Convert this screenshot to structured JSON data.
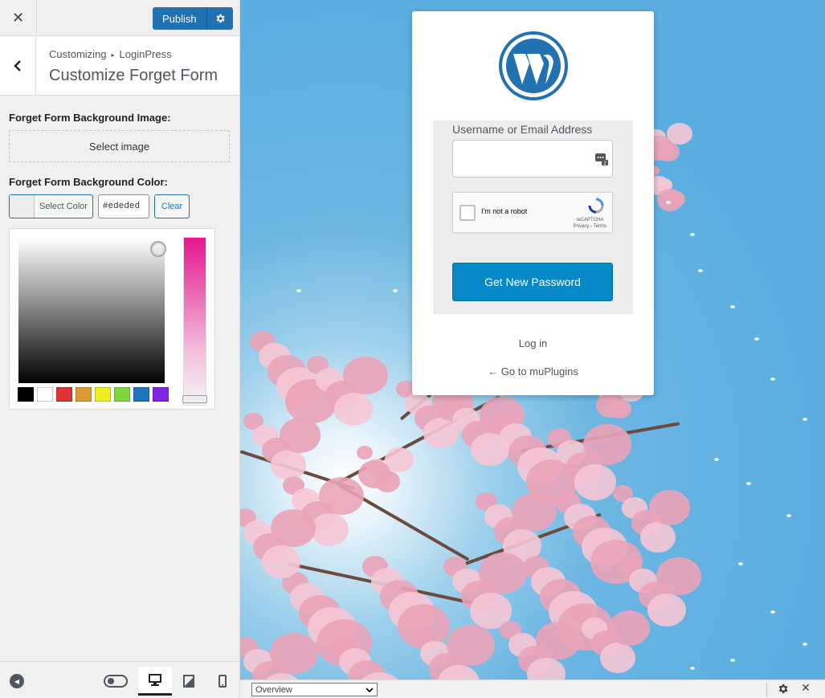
{
  "topbar": {
    "close_icon": "close-icon",
    "publish_label": "Publish",
    "publish_settings_icon": "gear-icon"
  },
  "section": {
    "breadcrumb_root": "Customizing",
    "breadcrumb_child": "LoginPress",
    "title": "Customize Forget Form"
  },
  "controls": {
    "bg_image_label": "Forget Form Background Image:",
    "select_image_label": "Select image",
    "bg_color_label": "Forget Form Background Color:",
    "select_color_label": "Select Color",
    "hex_value": "#ededed",
    "clear_label": "Clear",
    "palette": [
      "#000000",
      "#ffffff",
      "#dd3333",
      "#dd9933",
      "#eeee22",
      "#81d742",
      "#1e73be",
      "#8224e3"
    ],
    "current_color": "#ededed"
  },
  "preview": {
    "form_bg_color": "#ededed",
    "username_label": "Username or Email Address",
    "username_value": "",
    "recaptcha_text": "I'm not a robot",
    "recaptcha_brand": "reCAPTCHA",
    "recaptcha_links": "Privacy - Terms",
    "submit_label": "Get New Password",
    "login_link": "Log in",
    "back_link": "← Go to muPlugins"
  },
  "bottombar": {
    "select_value": "Overview"
  },
  "colors": {
    "accent": "#2271b1",
    "button": "#0789c7"
  }
}
